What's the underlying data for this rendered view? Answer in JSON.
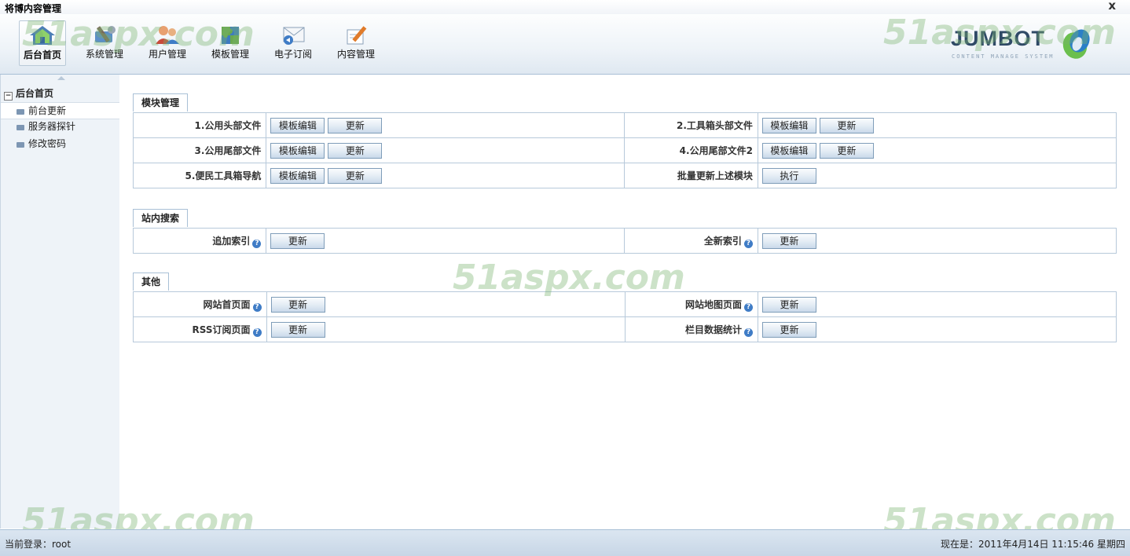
{
  "window": {
    "title": "将博内容管理",
    "close_glyph": "x"
  },
  "nav": [
    {
      "label": "后台首页",
      "icon": "home-icon",
      "active": true
    },
    {
      "label": "系统管理",
      "icon": "tools-icon"
    },
    {
      "label": "用户管理",
      "icon": "users-icon"
    },
    {
      "label": "模板管理",
      "icon": "puzzle-icon"
    },
    {
      "label": "电子订阅",
      "icon": "mail-icon"
    },
    {
      "label": "内容管理",
      "icon": "edit-icon"
    }
  ],
  "logo": {
    "brand": "JUMBOT",
    "tagline": "CONTENT MANAGE SYSTEM"
  },
  "sidebar": {
    "root": {
      "expander": "−",
      "label": "后台首页"
    },
    "items": [
      {
        "label": "前台更新",
        "selected": true
      },
      {
        "label": "服务器探针"
      },
      {
        "label": "修改密码"
      }
    ]
  },
  "sections": {
    "modules": {
      "title": "模块管理",
      "rows": [
        [
          {
            "label": "1.公用头部文件",
            "buttons": [
              "模板编辑",
              "更新"
            ]
          },
          {
            "label": "2.工具箱头部文件",
            "buttons": [
              "模板编辑",
              "更新"
            ]
          }
        ],
        [
          {
            "label": "3.公用尾部文件",
            "buttons": [
              "模板编辑",
              "更新"
            ]
          },
          {
            "label": "4.公用尾部文件2",
            "buttons": [
              "模板编辑",
              "更新"
            ]
          }
        ],
        [
          {
            "label": "5.便民工具箱导航",
            "buttons": [
              "模板编辑",
              "更新"
            ]
          },
          {
            "label": "批量更新上述模块",
            "buttons": [
              "执行"
            ]
          }
        ]
      ]
    },
    "search": {
      "title": "站内搜索",
      "rows": [
        [
          {
            "label": "追加索引",
            "help": true,
            "buttons": [
              "更新"
            ]
          },
          {
            "label": "全新索引",
            "help": true,
            "buttons": [
              "更新"
            ]
          }
        ]
      ]
    },
    "other": {
      "title": "其他",
      "rows": [
        [
          {
            "label": "网站首页面",
            "help": true,
            "buttons": [
              "更新"
            ]
          },
          {
            "label": "网站地图页面",
            "help": true,
            "buttons": [
              "更新"
            ]
          }
        ],
        [
          {
            "label": "RSS订阅页面",
            "help": true,
            "buttons": [
              "更新"
            ]
          },
          {
            "label": "栏目数据统计",
            "help": true,
            "buttons": [
              "更新"
            ]
          }
        ]
      ]
    }
  },
  "help_glyph": "?",
  "watermark": "51aspx.com",
  "status": {
    "login": "当前登录：root",
    "now": "现在是：2011年4月14日 11:15:46  星期四"
  }
}
